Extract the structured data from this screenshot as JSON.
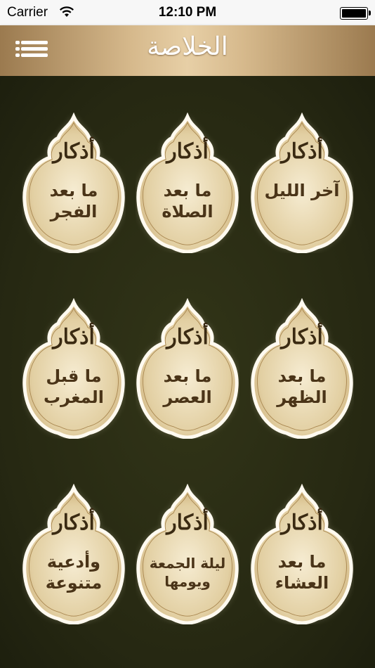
{
  "status_bar": {
    "carrier": "Carrier",
    "time": "12:10 PM"
  },
  "header": {
    "logo_text": "الخلاصة",
    "menu_icon": "hamburger-menu-icon"
  },
  "tiles": [
    {
      "heading": "أذكار",
      "label": "آخر الليل"
    },
    {
      "heading": "أذكار",
      "label": "ما بعد\nالصلاة"
    },
    {
      "heading": "أذكار",
      "label": "ما بعد\nالفجر"
    },
    {
      "heading": "أذكار",
      "label": "ما بعد\nالظهر"
    },
    {
      "heading": "أذكار",
      "label": "ما بعد\nالعصر"
    },
    {
      "heading": "أذكار",
      "label": "ما قبل\nالمغرب"
    },
    {
      "heading": "أذكار",
      "label": "ما بعد\nالعشاء"
    },
    {
      "heading": "أذكار",
      "label": "ليلة الجمعة\nويومها"
    },
    {
      "heading": "أذكار",
      "label": "وأدعية\nمتنوعة"
    }
  ],
  "colors": {
    "tile_fill": "#e9d9b4",
    "tile_border": "#fffaf0",
    "header_accent": "#d6b98c",
    "background": "#2a2c14"
  }
}
